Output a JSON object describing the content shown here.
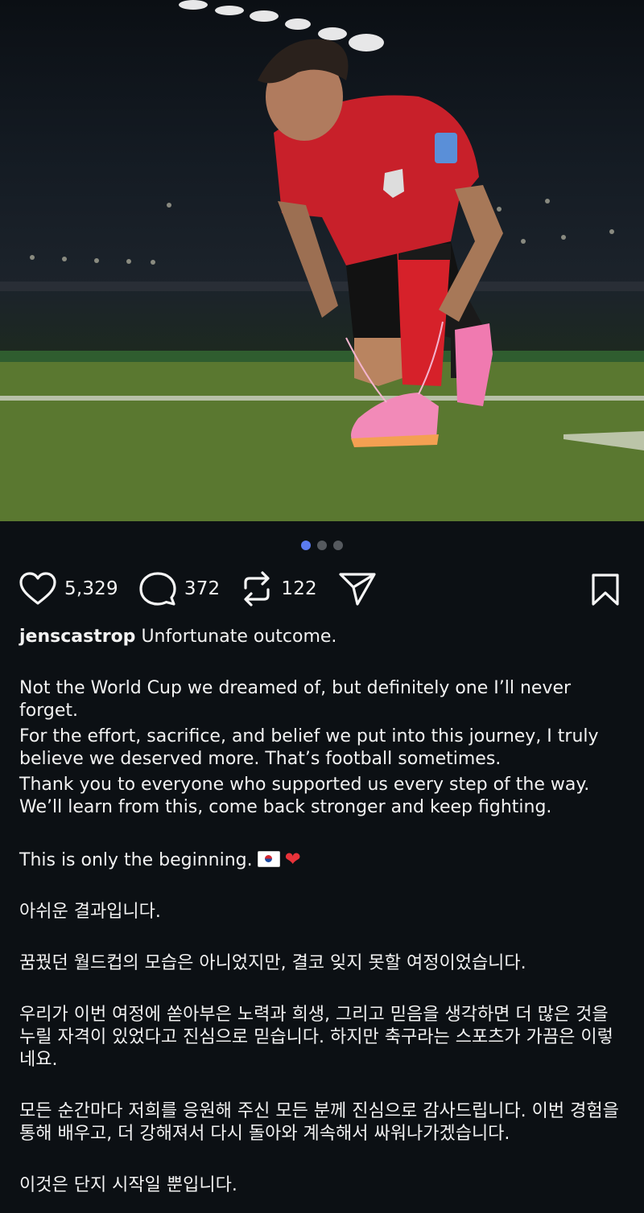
{
  "post": {
    "carousel": {
      "total": 3,
      "active_index": 1
    },
    "actions": {
      "likes": "5,329",
      "comments": "372",
      "reposts": "122"
    },
    "caption": {
      "username": "jenscastrop",
      "first_line": "Unfortunate outcome.",
      "para1": "Not the World Cup we dreamed of, but definitely one I’ll never forget.",
      "para2": "For the effort, sacrifice, and belief we put into this journey, I truly believe we deserved more. That’s football sometimes.",
      "para3": "Thank you to everyone who supported us every step of the way. We’ll learn from this, come back stronger and keep fighting.",
      "para4": "This is only the beginning.",
      "para4_emojis": [
        "south-korea-flag",
        "red-heart"
      ],
      "ko1": "아쉬운 결과입니다.",
      "ko2": "꿈꿨던 월드컵의 모습은 아니었지만, 결코 잊지 못할 여정이었습니다.",
      "ko3": "우리가 이번 여정에 쏟아부은 노력과 희생, 그리고 믿음을 생각하면 더 많은 것을 누릴 자격이 있었다고 진심으로 믿습니다. 하지만 축구라는 스포츠가 가끔은 이렇네요.",
      "ko4": "모든 순간마다 저희를 응원해 주신 모든 분께 진심으로 감사드립니다. 이번 경험을 통해 배우고, 더 강해져서 다시 돌아와 계속해서 싸워나가겠습니다.",
      "ko5": "이것은 단지 시작일 뿐입니다."
    }
  },
  "colors": {
    "background": "#0c1014",
    "carousel_active": "#5b7bf0",
    "jersey_red": "#c8202a",
    "boot_pink": "#f27bb0"
  }
}
